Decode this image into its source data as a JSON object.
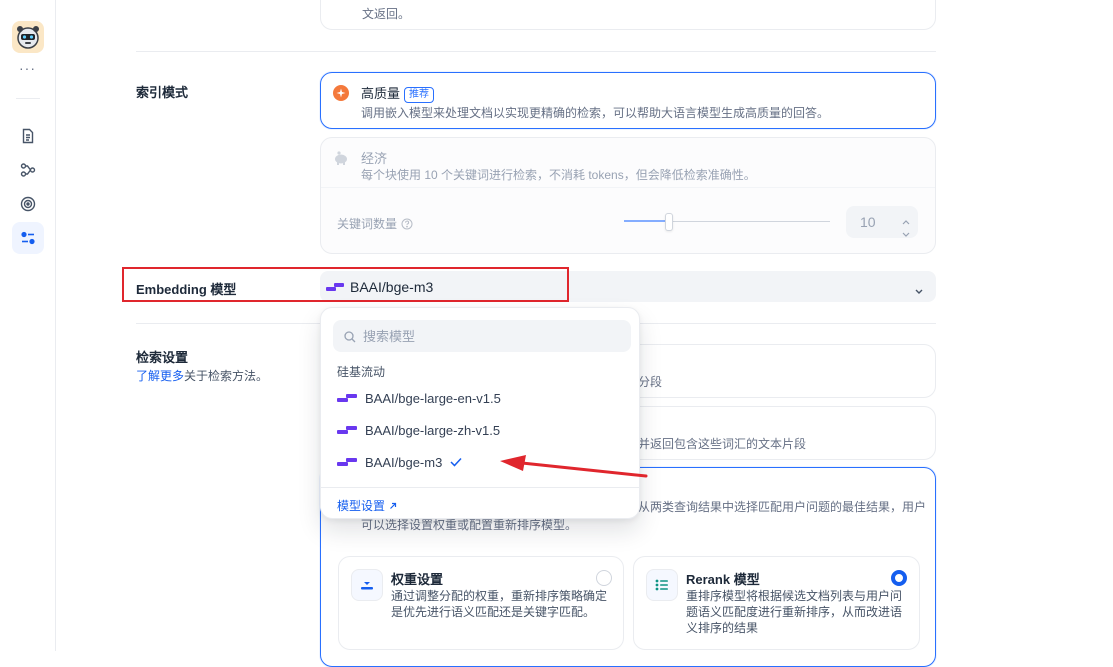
{
  "sidebar": {
    "more_label": "···",
    "items": [
      {
        "name": "document-icon"
      },
      {
        "name": "workflow-icon"
      },
      {
        "name": "target-icon"
      },
      {
        "name": "settings-sliders-icon",
        "active": true
      }
    ]
  },
  "top_card": {
    "desc_tail": "文返回。"
  },
  "index_mode": {
    "label": "索引模式",
    "high_quality": {
      "title": "高质量",
      "badge": "推荐",
      "desc": "调用嵌入模型来处理文档以实现更精确的检索，可以帮助大语言模型生成高质量的回答。",
      "selected": true
    },
    "economy": {
      "title": "经济",
      "desc": "每个块使用 10 个关键词进行检索，不消耗 tokens，但会降低检索准确性。"
    },
    "keyword_count": {
      "label": "关键词数量",
      "help_icon": "question-circle-icon",
      "value": "10",
      "slider_fraction": 0.22
    }
  },
  "embedding": {
    "label": "Embedding 模型",
    "selected": "BAAI/bge-m3",
    "dropdown": {
      "search_placeholder": "搜索模型",
      "provider": "硅基流动",
      "options": [
        {
          "label": "BAAI/bge-large-en-v1.5",
          "selected": false
        },
        {
          "label": "BAAI/bge-large-zh-v1.5",
          "selected": false
        },
        {
          "label": "BAAI/bge-m3",
          "selected": true
        }
      ],
      "footer_link": "模型设置"
    }
  },
  "retrieval": {
    "label": "检索设置",
    "learn_more": "了解更多",
    "learn_more_suffix": "关于检索方法。",
    "card1_tail": "分段",
    "card2_tail": "，并返回包含这些词汇的文本片段",
    "hybrid_desc_line1": "从两类查询结果中选择匹配用户问题的最佳结果，用户",
    "hybrid_desc_line2": "可以选择设置权重或配置重新排序模型。",
    "weight": {
      "title": "权重设置",
      "desc": "通过调整分配的权重，重新排序策略确定是优先进行语义匹配还是关键字匹配。",
      "selected": false
    },
    "rerank": {
      "title": "Rerank 模型",
      "desc": "重排序模型将根据候选文档列表与用户问题语义匹配度进行重新排序，从而改进语义排序的结果",
      "selected": true
    }
  },
  "colors": {
    "accent": "#2970ff",
    "highlight_red": "#e0262d",
    "model_icon": "#6938ef"
  }
}
